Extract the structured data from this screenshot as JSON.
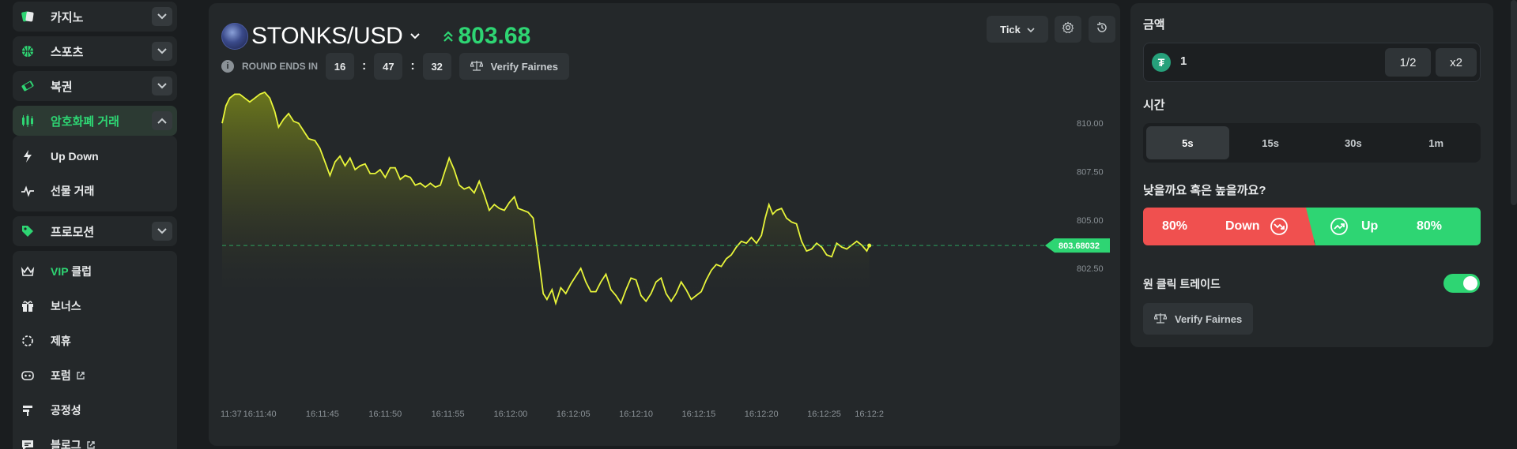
{
  "sidebar": {
    "top_items": [
      {
        "label": "카지노"
      },
      {
        "label": "스포츠"
      },
      {
        "label": "복권"
      }
    ],
    "active_item": {
      "label": "암호화폐 거래"
    },
    "sub_items": [
      {
        "label": "Up Down"
      },
      {
        "label": "선물 거래"
      }
    ],
    "promo": {
      "label": "프로모션"
    },
    "group": [
      {
        "label_prefix": "VIP",
        "label": " 클럽"
      },
      {
        "label": "보너스"
      },
      {
        "label": "제휴"
      },
      {
        "label": "포럼"
      },
      {
        "label": "공정성"
      },
      {
        "label": "블로그"
      }
    ]
  },
  "header": {
    "pair": "STONKS/USD",
    "price": "803.68",
    "round_label": "ROUND ENDS IN",
    "timer": {
      "h": "16",
      "m": "47",
      "s": "32"
    },
    "verify_label": "Verify Fairnes",
    "tick_label": "Tick"
  },
  "chart_data": {
    "type": "line",
    "current_price": 803.68032,
    "current_price_label": "803.68032",
    "y_ticks": [
      "810.00",
      "807.50",
      "805.00",
      "802.50"
    ],
    "y_tick_values": [
      810.0,
      807.5,
      805.0,
      802.5
    ],
    "ylim": [
      800.1,
      811.8
    ],
    "x_ticks": [
      "11:37",
      "16:11:40",
      "16:11:45",
      "16:11:50",
      "16:11:55",
      "16:12:00",
      "16:12:05",
      "16:12:10",
      "16:12:15",
      "16:12:20",
      "16:12:25",
      "16:12:2"
    ],
    "x_tick_values": [
      37.0,
      40.0,
      45.0,
      50.0,
      55.0,
      60.0,
      65.0,
      70.0,
      75.0,
      80.0,
      85.0,
      88.6
    ],
    "xlim": [
      37.0,
      89.0
    ],
    "line_color": "#e8f53a",
    "points": [
      [
        37.0,
        810.0
      ],
      [
        37.3,
        810.9
      ],
      [
        37.6,
        811.3
      ],
      [
        38.0,
        811.5
      ],
      [
        38.4,
        811.5
      ],
      [
        38.8,
        811.3
      ],
      [
        39.2,
        811.1
      ],
      [
        39.6,
        811.3
      ],
      [
        40.0,
        811.5
      ],
      [
        40.4,
        811.6
      ],
      [
        40.8,
        811.3
      ],
      [
        41.2,
        810.6
      ],
      [
        41.5,
        809.8
      ],
      [
        41.9,
        810.2
      ],
      [
        42.3,
        810.5
      ],
      [
        42.7,
        810.1
      ],
      [
        43.1,
        810.0
      ],
      [
        43.5,
        809.6
      ],
      [
        43.9,
        809.2
      ],
      [
        44.4,
        809.1
      ],
      [
        44.8,
        808.7
      ],
      [
        45.2,
        808.0
      ],
      [
        45.6,
        807.3
      ],
      [
        46.0,
        808.0
      ],
      [
        46.4,
        808.3
      ],
      [
        46.8,
        807.8
      ],
      [
        47.2,
        808.2
      ],
      [
        47.6,
        807.6
      ],
      [
        48.0,
        807.8
      ],
      [
        48.4,
        807.9
      ],
      [
        48.8,
        807.4
      ],
      [
        49.2,
        807.4
      ],
      [
        49.6,
        807.6
      ],
      [
        50.0,
        807.2
      ],
      [
        50.4,
        807.7
      ],
      [
        50.8,
        807.7
      ],
      [
        51.2,
        807.1
      ],
      [
        51.6,
        807.3
      ],
      [
        52.0,
        807.2
      ],
      [
        52.4,
        806.8
      ],
      [
        52.8,
        806.9
      ],
      [
        53.2,
        806.7
      ],
      [
        53.6,
        806.9
      ],
      [
        54.0,
        806.7
      ],
      [
        54.4,
        806.8
      ],
      [
        54.8,
        807.6
      ],
      [
        55.1,
        808.2
      ],
      [
        55.5,
        807.6
      ],
      [
        55.9,
        806.8
      ],
      [
        56.3,
        806.6
      ],
      [
        56.7,
        806.7
      ],
      [
        57.1,
        806.4
      ],
      [
        57.5,
        807.0
      ],
      [
        57.9,
        806.3
      ],
      [
        58.3,
        805.5
      ],
      [
        58.7,
        805.8
      ],
      [
        59.1,
        805.6
      ],
      [
        59.5,
        805.5
      ],
      [
        59.9,
        805.9
      ],
      [
        60.3,
        806.2
      ],
      [
        60.6,
        805.6
      ],
      [
        61.0,
        805.5
      ],
      [
        61.4,
        805.4
      ],
      [
        61.8,
        805.1
      ],
      [
        62.2,
        803.2
      ],
      [
        62.6,
        801.2
      ],
      [
        62.9,
        800.9
      ],
      [
        63.3,
        801.4
      ],
      [
        63.6,
        800.7
      ],
      [
        64.0,
        801.5
      ],
      [
        64.4,
        801.2
      ],
      [
        64.8,
        801.7
      ],
      [
        65.2,
        802.1
      ],
      [
        65.6,
        802.5
      ],
      [
        66.0,
        801.8
      ],
      [
        66.4,
        801.3
      ],
      [
        66.8,
        801.3
      ],
      [
        67.2,
        801.8
      ],
      [
        67.6,
        802.2
      ],
      [
        68.0,
        801.4
      ],
      [
        68.4,
        801.1
      ],
      [
        68.8,
        800.7
      ],
      [
        69.2,
        801.4
      ],
      [
        69.6,
        802.0
      ],
      [
        70.0,
        801.9
      ],
      [
        70.4,
        801.1
      ],
      [
        70.8,
        800.8
      ],
      [
        71.2,
        801.2
      ],
      [
        71.6,
        801.8
      ],
      [
        72.0,
        802.0
      ],
      [
        72.4,
        801.2
      ],
      [
        72.8,
        800.8
      ],
      [
        73.2,
        801.2
      ],
      [
        73.6,
        801.8
      ],
      [
        74.0,
        801.4
      ],
      [
        74.4,
        800.9
      ],
      [
        74.8,
        801.1
      ],
      [
        75.2,
        801.3
      ],
      [
        75.6,
        801.9
      ],
      [
        76.0,
        802.4
      ],
      [
        76.4,
        802.7
      ],
      [
        76.8,
        802.6
      ],
      [
        77.2,
        803.0
      ],
      [
        77.6,
        803.2
      ],
      [
        78.0,
        803.6
      ],
      [
        78.4,
        803.9
      ],
      [
        78.8,
        803.8
      ],
      [
        79.2,
        804.1
      ],
      [
        79.6,
        803.8
      ],
      [
        80.0,
        804.2
      ],
      [
        80.3,
        805.1
      ],
      [
        80.6,
        805.8
      ],
      [
        80.9,
        805.3
      ],
      [
        81.2,
        805.5
      ],
      [
        81.6,
        805.6
      ],
      [
        82.0,
        805.1
      ],
      [
        82.4,
        804.9
      ],
      [
        82.8,
        804.8
      ],
      [
        83.2,
        803.9
      ],
      [
        83.6,
        803.4
      ],
      [
        84.0,
        803.5
      ],
      [
        84.4,
        803.8
      ],
      [
        84.8,
        803.6
      ],
      [
        85.2,
        803.2
      ],
      [
        85.6,
        803.1
      ],
      [
        86.0,
        803.8
      ],
      [
        86.4,
        803.6
      ],
      [
        86.8,
        803.5
      ],
      [
        87.2,
        803.7
      ],
      [
        87.6,
        803.9
      ],
      [
        88.0,
        803.7
      ],
      [
        88.4,
        803.4
      ],
      [
        88.6,
        803.68
      ]
    ]
  },
  "order": {
    "amount_label": "금액",
    "amount_value": "1",
    "half_label": "1/2",
    "double_label": "x2",
    "time_label": "시간",
    "time_options": [
      "5s",
      "15s",
      "30s",
      "1m"
    ],
    "selected_time": "5s",
    "direction_label": "낮을까요 혹은 높을까요?",
    "down_pct": "80%",
    "down_label": "Down",
    "up_label": "Up",
    "up_pct": "80%",
    "one_click_label": "원 클릭 트레이드",
    "verify_label": "Verify Fairnes"
  },
  "colors": {
    "accent_green": "#2ed573",
    "down_red": "#f0504f",
    "line_yellow": "#e8f53a"
  }
}
